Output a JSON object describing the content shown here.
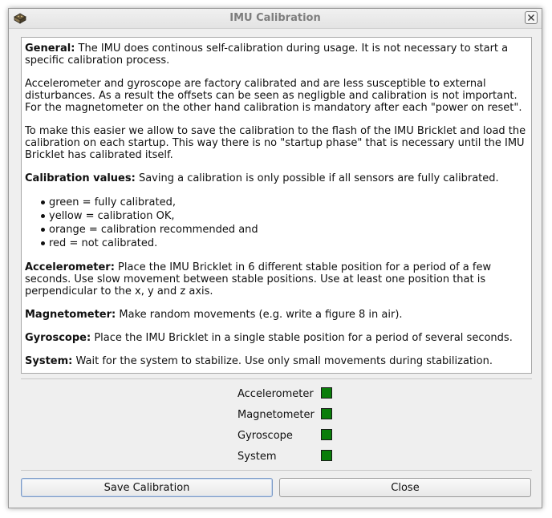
{
  "window": {
    "title": "IMU Calibration"
  },
  "info": {
    "general_label": "General:",
    "general_text": " The IMU does continous self-calibration during usage. It is not necessary to start a specific calibration process.",
    "accel_gyro_text": "Accelerometer and gyroscope are factory calibrated and are less susceptible to external disturbances. As a result the offsets can be seen as negligble and calibration is not important. For the magnetometer on the other hand calibration is mandatory after each \"power on reset\".",
    "flash_text": "To make this easier we allow to save the calibration to the flash of the IMU Bricklet and load the calibration on each startup. This way there is no \"startup phase\" that is necessary until the IMU Bricklet has calibrated itself.",
    "calib_values_label": "Calibration values:",
    "calib_values_text": " Saving a calibration is only possible if all sensors are fully calibrated.",
    "legend": [
      "green = fully calibrated,",
      "yellow = calibration OK,",
      "orange = calibration recommended and",
      "red = not calibrated."
    ],
    "accelerometer_label": "Accelerometer:",
    "accelerometer_text": " Place the IMU Bricklet in 6 different stable position for a period of a few seconds. Use slow movement between stable positions. Use at least one position that is perpendicular to the x, y and z axis.",
    "magnetometer_label": "Magnetometer:",
    "magnetometer_text": " Make random movements (e.g. write a figure 8 in air).",
    "gyroscope_label": "Gyroscope:",
    "gyroscope_text": " Place the IMU Bricklet in a single stable position for a period of several seconds.",
    "system_label": "System:",
    "system_text": " Wait for the system to stabilize. Use only small movements during stabilization."
  },
  "status": [
    {
      "label": "Accelerometer",
      "color": "#0a7d0a"
    },
    {
      "label": "Magnetometer",
      "color": "#0a7d0a"
    },
    {
      "label": "Gyroscope",
      "color": "#0a7d0a"
    },
    {
      "label": "System",
      "color": "#0a7d0a"
    }
  ],
  "buttons": {
    "save": "Save Calibration",
    "close": "Close"
  }
}
